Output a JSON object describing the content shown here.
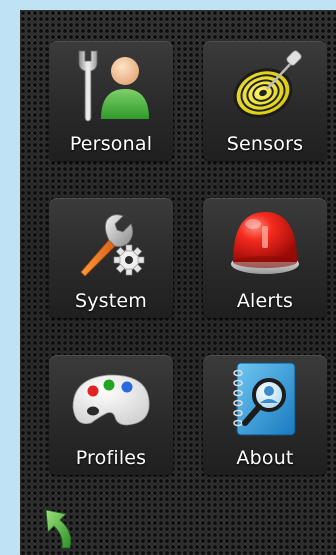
{
  "tiles": [
    {
      "label": "Personal",
      "icon": "person-wrench-icon"
    },
    {
      "label": "Sensors",
      "icon": "target-sensor-icon"
    },
    {
      "label": "System",
      "icon": "wrench-gear-icon"
    },
    {
      "label": "Alerts",
      "icon": "red-alarm-light-icon"
    },
    {
      "label": "Profiles",
      "icon": "paint-palette-icon"
    },
    {
      "label": "About",
      "icon": "notebook-magnifier-icon"
    }
  ],
  "nav": {
    "back_icon": "back-arrow-icon"
  },
  "colors": {
    "page_background": "#bfe3f5",
    "tile_text": "#ffffff",
    "alert_red": "#e0201a",
    "back_arrow_green": "#4cb54a"
  }
}
